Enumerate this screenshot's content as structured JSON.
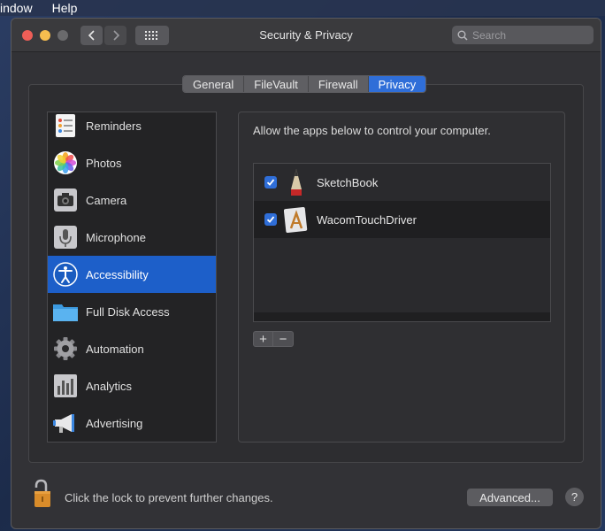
{
  "menubar": {
    "items": [
      "indow",
      "Help"
    ]
  },
  "window": {
    "title": "Security & Privacy"
  },
  "search": {
    "placeholder": "Search"
  },
  "tabs": [
    {
      "label": "General"
    },
    {
      "label": "FileVault"
    },
    {
      "label": "Firewall"
    },
    {
      "label": "Privacy",
      "active": true
    }
  ],
  "sidebar": {
    "items": [
      {
        "label": "Reminders",
        "icon": "reminders-icon"
      },
      {
        "label": "Photos",
        "icon": "photos-icon"
      },
      {
        "label": "Camera",
        "icon": "camera-icon"
      },
      {
        "label": "Microphone",
        "icon": "microphone-icon"
      },
      {
        "label": "Accessibility",
        "icon": "accessibility-icon",
        "selected": true
      },
      {
        "label": "Full Disk Access",
        "icon": "folder-icon"
      },
      {
        "label": "Automation",
        "icon": "gear-icon"
      },
      {
        "label": "Analytics",
        "icon": "analytics-icon"
      },
      {
        "label": "Advertising",
        "icon": "megaphone-icon"
      }
    ]
  },
  "main": {
    "description": "Allow the apps below to control your computer.",
    "apps": [
      {
        "name": "SketchBook",
        "checked": true,
        "icon": "sketchbook-icon"
      },
      {
        "name": "WacomTouchDriver",
        "checked": true,
        "icon": "wacom-icon"
      }
    ],
    "add_label": "+",
    "remove_label": "−"
  },
  "footer": {
    "lock_text": "Click the lock to prevent further changes.",
    "advanced_label": "Advanced...",
    "help_label": "?"
  },
  "colors": {
    "accent": "#2f6ed8",
    "selection": "#1d5fc9"
  }
}
